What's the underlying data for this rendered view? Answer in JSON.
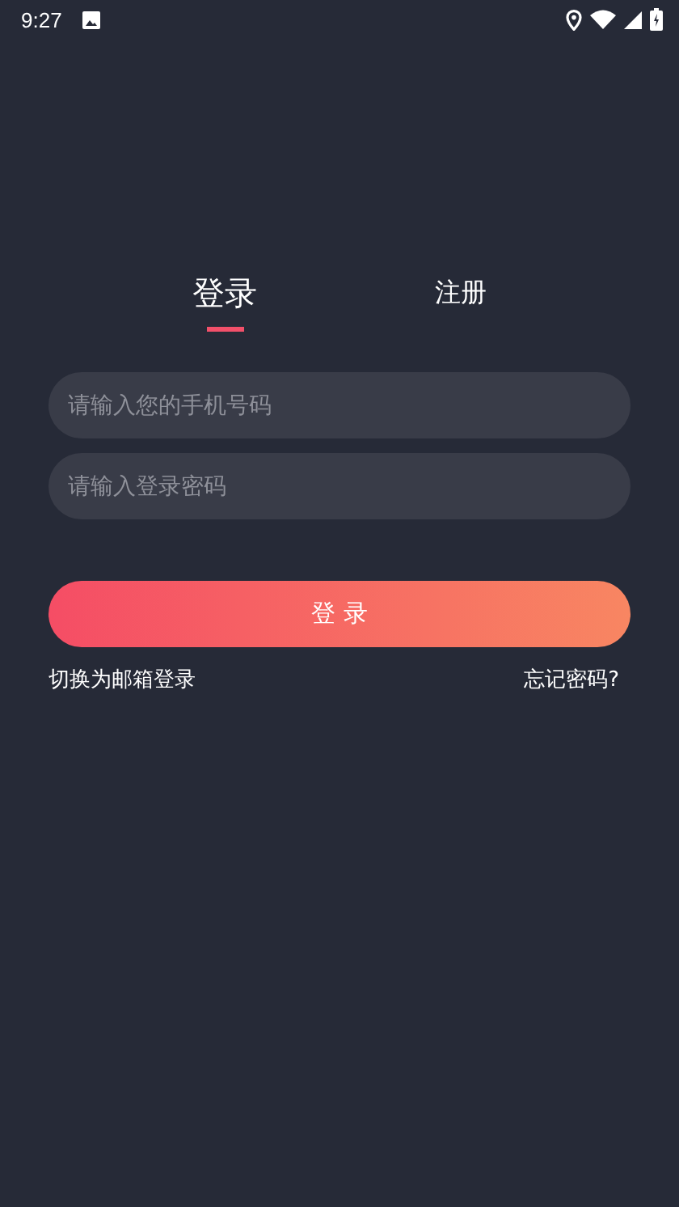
{
  "status_bar": {
    "time": "9:27"
  },
  "tabs": [
    {
      "label": "登录",
      "selected": true
    },
    {
      "label": "注册",
      "selected": false
    }
  ],
  "fields": [
    {
      "placeholder": "请输入您的手机号码"
    },
    {
      "placeholder": "请输入登录密码"
    }
  ],
  "login_button": "登 录",
  "links": {
    "switch": "切换为邮箱登录",
    "forgot": "忘记密码?"
  }
}
